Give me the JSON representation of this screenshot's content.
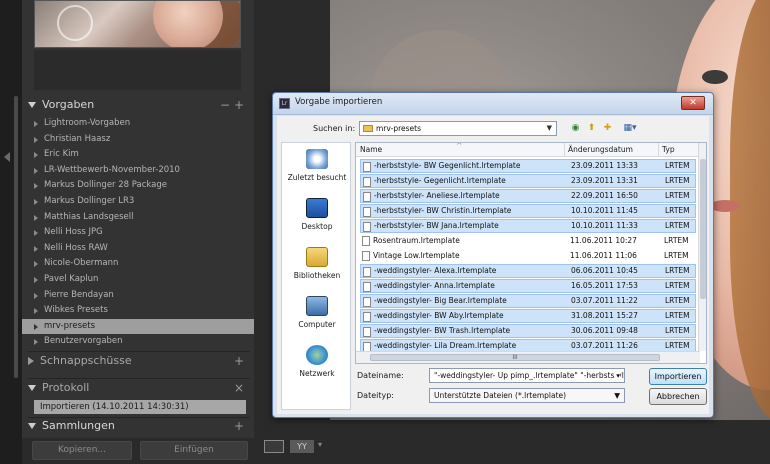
{
  "left_panel": {
    "vorgaben": {
      "title": "Vorgaben",
      "minus": "−",
      "plus": "+",
      "items": [
        {
          "label": "Lightroom-Vorgaben"
        },
        {
          "label": "Christian Haasz"
        },
        {
          "label": "Eric Kim"
        },
        {
          "label": "LR-Wettbewerb-November-2010"
        },
        {
          "label": "Markus Dollinger 28 Package"
        },
        {
          "label": "Markus Dollinger LR3"
        },
        {
          "label": "Matthias Landsgesell"
        },
        {
          "label": "Nelli Hoss JPG"
        },
        {
          "label": "Nelli Hoss RAW"
        },
        {
          "label": "Nicole-Obermann"
        },
        {
          "label": "Pavel Kaplun"
        },
        {
          "label": "Pierre Bendayan"
        },
        {
          "label": "Wibkes Presets"
        },
        {
          "label": "mrv-presets"
        },
        {
          "label": "Benutzervorgaben"
        }
      ],
      "selected_label": "mrv-presets"
    },
    "schnappschuesse": {
      "title": "Schnappschüsse",
      "plus": "+"
    },
    "protokoll": {
      "title": "Protokoll",
      "close": "×",
      "entry": "Importieren (14.10.2011 14:30:31)"
    },
    "sammlungen": {
      "title": "Sammlungen",
      "plus": "+"
    },
    "buttons": {
      "copy": "Kopieren...",
      "paste": "Einfügen"
    }
  },
  "toolbar": {
    "yy_label": "YY",
    "caret": "▾"
  },
  "dialog": {
    "title": "Vorgabe importieren",
    "close": "✕",
    "look_in_label": "Suchen in:",
    "look_in_value": "mrv-presets",
    "places": [
      {
        "label": "Zuletzt besucht",
        "icon": "recent-icon"
      },
      {
        "label": "Desktop",
        "icon": "desktop-icon"
      },
      {
        "label": "Bibliotheken",
        "icon": "library-icon"
      },
      {
        "label": "Computer",
        "icon": "computer-icon"
      },
      {
        "label": "Netzwerk",
        "icon": "network-icon"
      }
    ],
    "columns": {
      "name": "Name",
      "date": "Änderungsdatum",
      "type": "Typ",
      "sort": "^"
    },
    "files": [
      {
        "name": "-herbststyle- BW Gegenlicht.lrtemplate",
        "date": "23.09.2011 13:33",
        "type": "LRTEM",
        "selected": true
      },
      {
        "name": "-herbststyle- Gegenlicht.lrtemplate",
        "date": "23.09.2011 13:31",
        "type": "LRTEM",
        "selected": true
      },
      {
        "name": "-herbststyler- Aneliese.lrtemplate",
        "date": "22.09.2011 16:50",
        "type": "LRTEM",
        "selected": true
      },
      {
        "name": "-herbststyler- BW Christin.lrtemplate",
        "date": "10.10.2011 11:45",
        "type": "LRTEM",
        "selected": true
      },
      {
        "name": "-herbststyler- BW Jana.lrtemplate",
        "date": "10.10.2011 11:33",
        "type": "LRTEM",
        "selected": true
      },
      {
        "name": "Rosentraum.lrtemplate",
        "date": "11.06.2011 10:27",
        "type": "LRTEM",
        "selected": false
      },
      {
        "name": "Vintage Low.lrtemplate",
        "date": "11.06.2011 11:06",
        "type": "LRTEM",
        "selected": false
      },
      {
        "name": "-weddingstyler- Alexa.lrtemplate",
        "date": "06.06.2011 10:45",
        "type": "LRTEM",
        "selected": true
      },
      {
        "name": "-weddingstyler- Anna.lrtemplate",
        "date": "16.05.2011 17:53",
        "type": "LRTEM",
        "selected": true
      },
      {
        "name": "-weddingstyler- Big Bear.lrtemplate",
        "date": "03.07.2011 11:22",
        "type": "LRTEM",
        "selected": true
      },
      {
        "name": "-weddingstyler- BW Aby.lrtemplate",
        "date": "31.08.2011 15:27",
        "type": "LRTEM",
        "selected": true
      },
      {
        "name": "-weddingstyler- BW Trash.lrtemplate",
        "date": "30.06.2011 09:48",
        "type": "LRTEM",
        "selected": true
      },
      {
        "name": "-weddingstyler- Lila Dream.lrtemplate",
        "date": "03.07.2011 11:26",
        "type": "LRTEM",
        "selected": true
      }
    ],
    "hscroll_grip": "III",
    "filename_label": "Dateiname:",
    "filename_value": "\"-weddingstyler- Up pimp_.lrtemplate\" \"-herbststyle- BW Gegenlicht.lrtemplate\"",
    "filetype_label": "Dateityp:",
    "filetype_value": "Unterstützte Dateien (*.lrtemplate)",
    "import_button": "Importieren",
    "cancel_button": "Abbrechen"
  },
  "colors": {
    "panel_bg": "#333333",
    "dialog_accent": "#cde3f9",
    "selected_preset_bg": "#9e9e9e"
  }
}
